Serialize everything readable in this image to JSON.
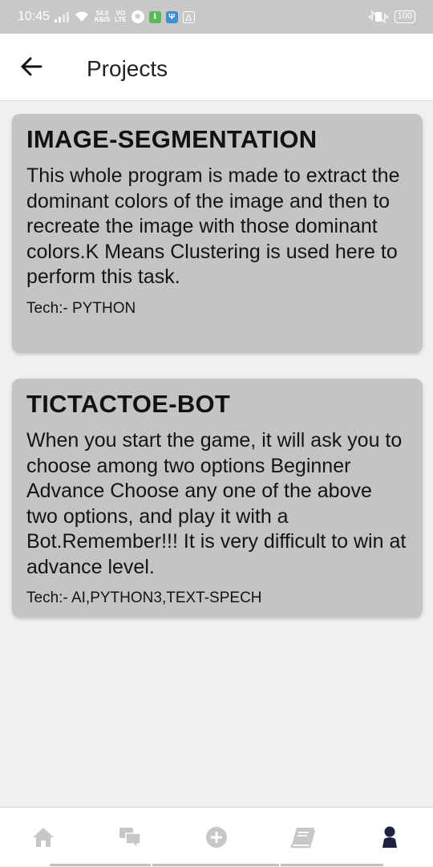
{
  "status_bar": {
    "time": "10:45",
    "net_speed": "54.0",
    "net_unit": "KB/S",
    "volte_top": "VO",
    "volte_bottom": "LTE",
    "battery": "100"
  },
  "header": {
    "title": "Projects",
    "back_icon": "arrow-left-icon"
  },
  "projects": [
    {
      "title": "IMAGE-SEGMENTATION",
      "description": "This whole program is made to extract the dominant colors of the image and then to recreate the image with those dominant colors.K Means Clustering is used here to perform this task.",
      "tech": "Tech:- PYTHON"
    },
    {
      "title": "TICTACTOE-BOT",
      "description": "When you start the game, it will ask you to choose among two options Beginner Advance Choose any one of the above two options, and play it with a Bot.Remember!!! It is very difficult to win at advance level.",
      "tech": "Tech:- AI,PYTHON3,TEXT-SPECH"
    }
  ],
  "bottom_nav": {
    "items": [
      {
        "icon": "home-icon",
        "active": false
      },
      {
        "icon": "chat-icon",
        "active": false
      },
      {
        "icon": "add-circle-icon",
        "active": false
      },
      {
        "icon": "book-icon",
        "active": false
      },
      {
        "icon": "person-icon",
        "active": true
      }
    ],
    "inactive_color": "#c7c7c7",
    "active_color": "#1c2340"
  }
}
